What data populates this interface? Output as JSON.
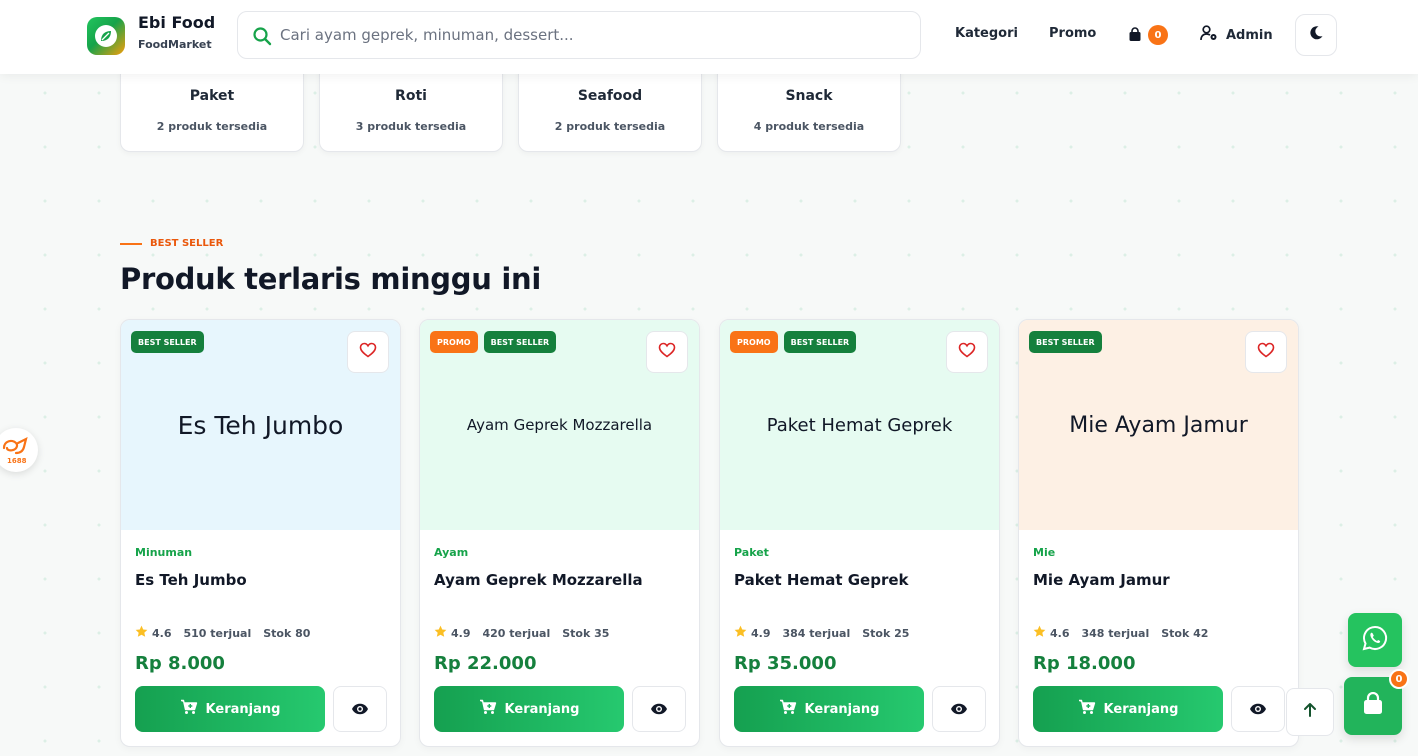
{
  "header": {
    "brand_name": "Ebi Food",
    "brand_sub": "FoodMarket",
    "search_placeholder": "Cari ayam geprek, minuman, dessert...",
    "nav": [
      "Kategori",
      "Promo"
    ],
    "cart_count": "0",
    "admin_label": "Admin",
    "icons": {
      "search": "search-icon",
      "cart": "shopping-bag-icon",
      "user": "user-gear-icon",
      "theme": "moon-icon"
    }
  },
  "categories": [
    {
      "name": "Paket",
      "count": "2 produk tersedia"
    },
    {
      "name": "Roti",
      "count": "3 produk tersedia"
    },
    {
      "name": "Seafood",
      "count": "2 produk tersedia"
    },
    {
      "name": "Snack",
      "count": "4 produk tersedia"
    }
  ],
  "section": {
    "eyebrow": "BEST SELLER",
    "title": "Produk terlaris minggu ini"
  },
  "products": [
    {
      "image_text": "Es Teh Jumbo",
      "image_bg": "#e7f6fd",
      "badges": [
        "BEST SELLER"
      ],
      "category": "Minuman",
      "name": "Es Teh Jumbo",
      "rating": "4.6",
      "sold": "510 terjual",
      "stock": "Stok 80",
      "price": "Rp 8.000",
      "add_label": "Keranjang"
    },
    {
      "image_text": "Ayam Geprek Mozzarella",
      "image_bg": "#e6fbf1",
      "badges": [
        "PROMO",
        "BEST SELLER"
      ],
      "category": "Ayam",
      "name": "Ayam Geprek Mozzarella",
      "rating": "4.9",
      "sold": "420 terjual",
      "stock": "Stok 35",
      "price": "Rp 22.000",
      "add_label": "Keranjang"
    },
    {
      "image_text": "Paket Hemat Geprek",
      "image_bg": "#e6fbf1",
      "badges": [
        "PROMO",
        "BEST SELLER"
      ],
      "category": "Paket",
      "name": "Paket Hemat Geprek",
      "rating": "4.9",
      "sold": "384 terjual",
      "stock": "Stok 25",
      "price": "Rp 35.000",
      "add_label": "Keranjang"
    },
    {
      "image_text": "Mie Ayam Jamur",
      "image_bg": "#fdf0e4",
      "badges": [
        "BEST SELLER"
      ],
      "category": "Mie",
      "name": "Mie Ayam Jamur",
      "rating": "4.6",
      "sold": "348 terjual",
      "stock": "Stok 42",
      "price": "Rp 18.000",
      "add_label": "Keranjang"
    }
  ],
  "floating": {
    "cart_count": "0",
    "side_tab_logo": "1688",
    "icons": {
      "whatsapp": "whatsapp-icon",
      "scroll_top": "arrow-up-icon",
      "cart": "shopping-bag-icon"
    }
  },
  "colors": {
    "accent_green": "#16a34a",
    "accent_orange": "#f97316"
  }
}
